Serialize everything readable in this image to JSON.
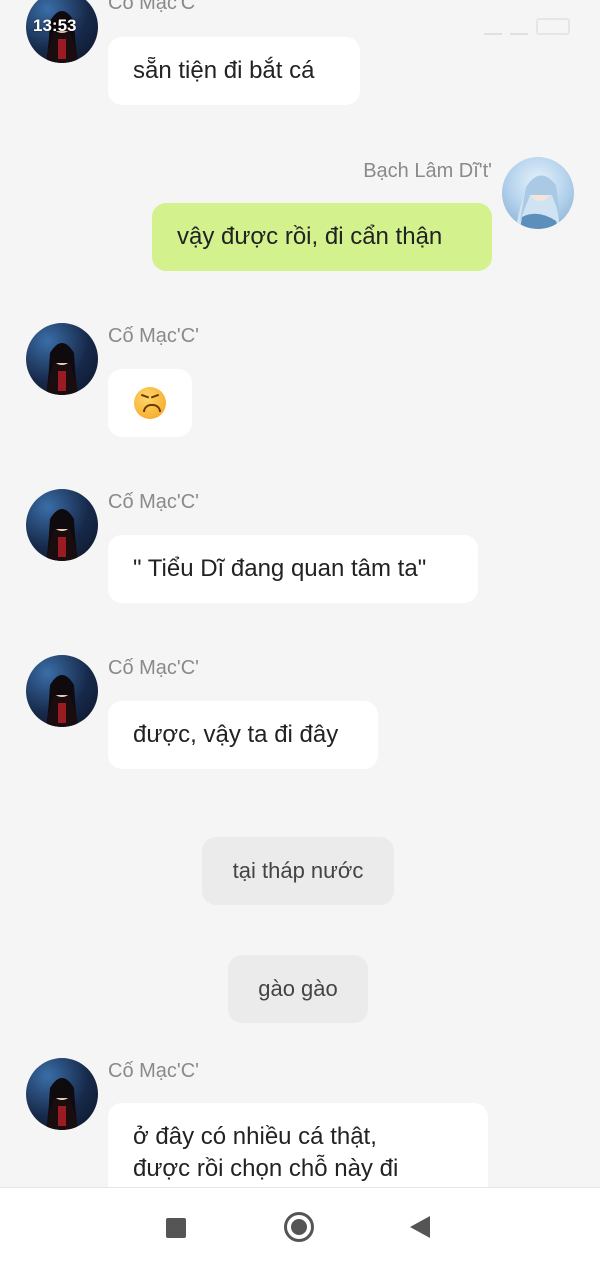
{
  "status_bar": {
    "time": "13:53"
  },
  "messages": [
    {
      "sender": "Cố Mạc'C'",
      "text": "sẵn tiện đi bắt cá"
    },
    {
      "sender": "Bạch Lâm Dĩ't'",
      "text": "vậy được rồi, đi cẩn thận"
    },
    {
      "sender": "Cố Mạc'C'",
      "emoji": "persevering-face-emoji"
    },
    {
      "sender": "Cố Mạc'C'",
      "text": "\" Tiểu Dĩ đang quan tâm ta\""
    },
    {
      "sender": "Cố Mạc'C'",
      "text": "được, vậy ta đi đây"
    },
    {
      "system": "tại tháp nước"
    },
    {
      "system": "gào gào"
    },
    {
      "sender": "Cố Mạc'C'",
      "text_line1": "ở đây có nhiều cá thật,",
      "text_line2": "được rồi chọn chỗ này đi"
    }
  ],
  "colors": {
    "background": "#f5f5f5",
    "incoming_bubble": "#ffffff",
    "outgoing_bubble": "#d3f28d",
    "system_bubble": "#ebebeb",
    "sender_name": "#8a8a8a"
  },
  "nav_bar": {
    "icons": [
      "recent-apps-icon",
      "home-icon",
      "back-icon"
    ]
  }
}
